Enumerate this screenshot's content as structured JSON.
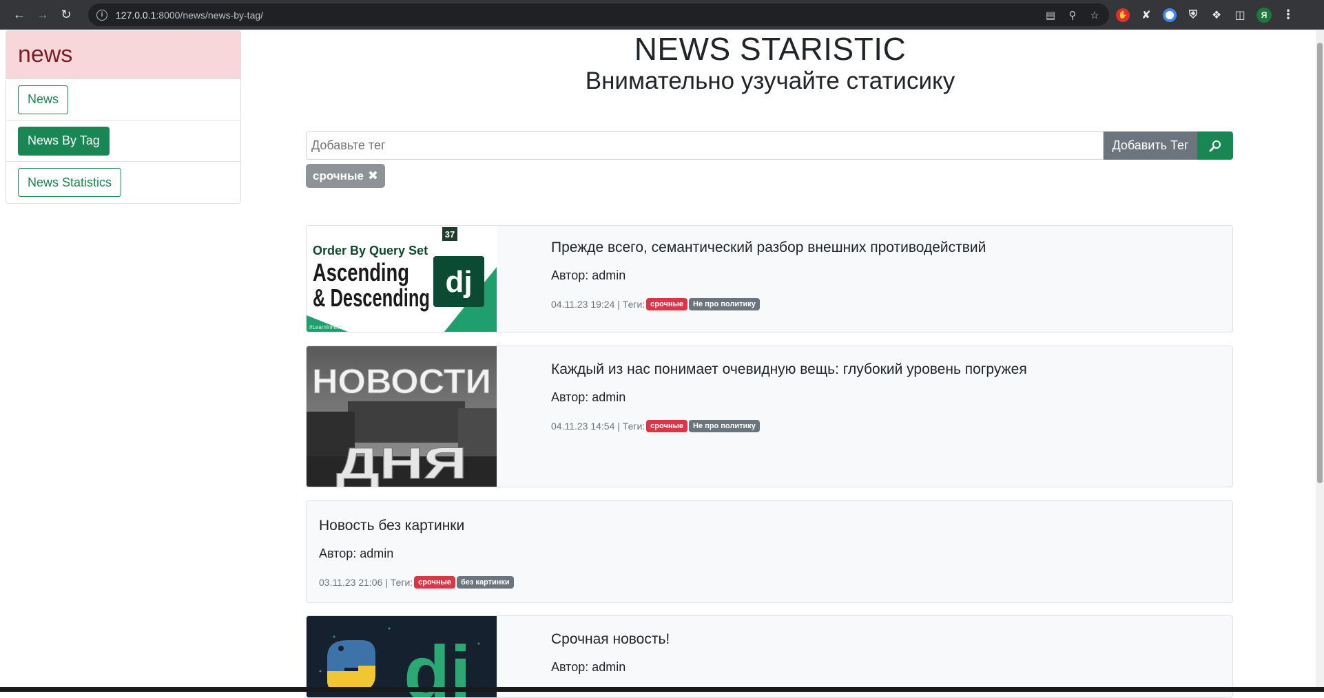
{
  "browser": {
    "url_host": "127.0.0.1",
    "url_rest": ":8000/news/news-by-tag/"
  },
  "sidebar": {
    "title": "news",
    "items": [
      {
        "label": "News"
      },
      {
        "label": "News By Tag"
      },
      {
        "label": "News Statistics"
      }
    ]
  },
  "header": {
    "title": "NEWS STARISTIC",
    "subtitle": "Внимательно узучайте статисику"
  },
  "search": {
    "placeholder": "Добавьте тег",
    "add_button": "Добавить Тег"
  },
  "active_tag": {
    "label": "срочные"
  },
  "cards": [
    {
      "title": "Прежде всего, семантический разбор внешних противодействий",
      "author": "Автор: admin",
      "meta": "04.11.23 19:24 | Теги:",
      "tags": [
        "срочные",
        "Не про политику"
      ],
      "image": {
        "line1": "Order By Query Set",
        "line2": "Ascending",
        "line3": "& Descending",
        "badge": "37",
        "logo": "dj",
        "footer": "#LearnInHindi"
      }
    },
    {
      "title": "Каждый из нас понимает очевидную вещь: глубокий уровень погружея",
      "author": "Автор: admin",
      "meta": "04.11.23 14:54 | Теги:",
      "tags": [
        "срочные",
        "Не про политику"
      ],
      "image": {
        "line1": "НОВОСТИ",
        "line2": "ДНЯ"
      }
    },
    {
      "title": "Новость без картинки",
      "author": "Автор: admin",
      "meta": "03.11.23 21:06 | Теги:",
      "tags": [
        "срочные",
        "без картинки"
      ]
    },
    {
      "title": "Срочная новость!",
      "author": "Автор: admin",
      "image": {
        "logo": "dj"
      }
    }
  ],
  "colors": {
    "success": "#198754",
    "secondary": "#6c757d",
    "danger": "#dc3545",
    "sidebar_header_bg": "#f8d7da"
  }
}
